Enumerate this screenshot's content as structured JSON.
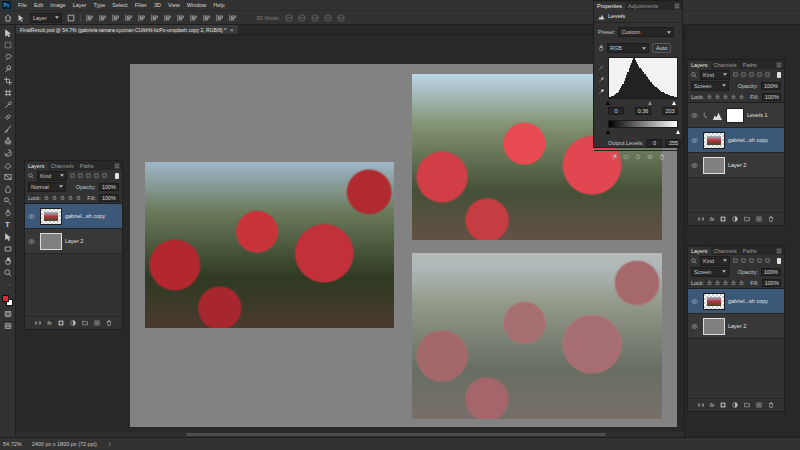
{
  "app": {
    "logo": "Ps"
  },
  "menu": [
    "File",
    "Edit",
    "Image",
    "Layer",
    "Type",
    "Select",
    "Filter",
    "3D",
    "View",
    "Window",
    "Help"
  ],
  "options_bar": {
    "target": "Layer",
    "mode_label": "3D Mode:"
  },
  "document_tab": {
    "title": "FinalResult.psd @ 54.7% (gabriela-tamara-cycman-CUlkhN-bcPo-unsplash copy 2, RGB/8) *",
    "close": "×"
  },
  "toolbar": {
    "type_tool": "T",
    "swatches": [
      {
        "name": "foreground",
        "color": "#e3262b"
      },
      {
        "name": "background",
        "color": "#ffffff"
      }
    ]
  },
  "canvas": {
    "images": [
      {
        "kind": "original"
      },
      {
        "kind": "levels"
      },
      {
        "kind": "screen"
      }
    ]
  },
  "properties_panel": {
    "tabs": [
      {
        "label": "Properties",
        "selected": true
      },
      {
        "label": "Adjustments",
        "selected": false
      }
    ],
    "title": "Levels",
    "preset_label": "Preset:",
    "preset": "Custom",
    "channel": "RGB",
    "auto_button": "Auto",
    "histogram": {
      "values": [
        2,
        3,
        4,
        6,
        8,
        10,
        13,
        16,
        20,
        25,
        30,
        36,
        42,
        50,
        58,
        66,
        74,
        82,
        88,
        94,
        100,
        96,
        90,
        85,
        80,
        76,
        72,
        68,
        64,
        60,
        56,
        52,
        48,
        44,
        40,
        36,
        33,
        30,
        27,
        24,
        22,
        20,
        18,
        16,
        14,
        12,
        10,
        9,
        8,
        7,
        6,
        5,
        4,
        3,
        3,
        2
      ]
    },
    "input_sliders": [
      {
        "name": "black",
        "level": 0
      },
      {
        "name": "midtone",
        "level": 0.6
      },
      {
        "name": "white",
        "level": 0.94
      }
    ],
    "input_levels": [
      "0",
      "0.36",
      "203"
    ],
    "output_sliders": [
      {
        "name": "black",
        "level": 0
      },
      {
        "name": "white",
        "level": 1
      }
    ],
    "output_label": "Output Levels:",
    "output_levels": [
      "0",
      "255"
    ]
  },
  "layers_panels": [
    {
      "tabs": [
        {
          "label": "Layers",
          "selected": true
        },
        {
          "label": "Channels",
          "selected": false
        },
        {
          "label": "Paths",
          "selected": false
        }
      ],
      "filter": "Kind",
      "blend_mode": "Normal",
      "opacity_label": "Opacity:",
      "opacity": "100%",
      "lock_label": "Lock:",
      "fill_label": "Fill:",
      "fill": "100%",
      "fx_button": "fx",
      "layers": [
        {
          "name": "gabriel...sh copy",
          "kind": "image",
          "visible": true,
          "selected": true
        },
        {
          "name": "Layer 2",
          "kind": "fill",
          "visible": true,
          "selected": false
        }
      ]
    },
    {
      "tabs": [
        {
          "label": "Layers",
          "selected": true
        },
        {
          "label": "Channels",
          "selected": false
        },
        {
          "label": "Paths",
          "selected": false
        }
      ],
      "filter": "Kind",
      "blend_mode": "Screen",
      "opacity_label": "Opacity:",
      "opacity": "100%",
      "lock_label": "Lock:",
      "fill_label": "Fill:",
      "fill": "100%",
      "fx_button": "fx",
      "layers": [
        {
          "name": "Levels 1",
          "kind": "adjustment",
          "visible": true,
          "selected": false
        },
        {
          "name": "gabriel...sh copy",
          "kind": "image",
          "visible": true,
          "selected": true
        },
        {
          "name": "Layer 2",
          "kind": "fill",
          "visible": true,
          "selected": false
        }
      ]
    },
    {
      "tabs": [
        {
          "label": "Layers",
          "selected": true
        },
        {
          "label": "Channels",
          "selected": false
        },
        {
          "label": "Paths",
          "selected": false
        }
      ],
      "filter": "Kind",
      "blend_mode": "Screen",
      "opacity_label": "Opacity:",
      "opacity": "100%",
      "lock_label": "Lock:",
      "fill_label": "Fill:",
      "fill": "100%",
      "fx_button": "fx",
      "layers": [
        {
          "name": "gabriel...sh copy",
          "kind": "image",
          "visible": true,
          "selected": true
        },
        {
          "name": "Layer 2",
          "kind": "fill",
          "visible": true,
          "selected": false
        }
      ]
    }
  ],
  "status_bar": {
    "zoom": "54.72%",
    "doc_info": "2400 px x 1800 px (72 ppi)"
  }
}
